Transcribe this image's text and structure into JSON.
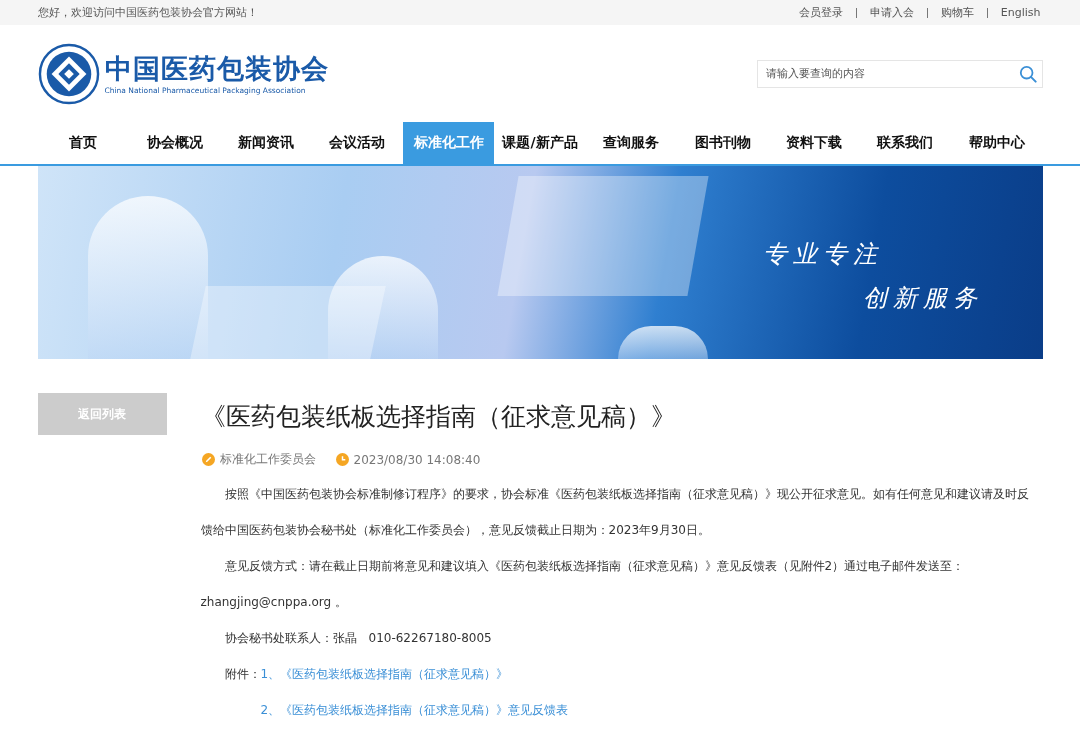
{
  "top_bar": {
    "greeting": "您好，欢迎访问中国医药包装协会官方网站！",
    "links": [
      "会员登录",
      "申请入会",
      "购物车",
      "English"
    ]
  },
  "header": {
    "logo_title": "中国医药包装协会",
    "logo_subtitle": "China National Pharmaceutical Packaging Association",
    "search": {
      "placeholder": "请输入要查询的内容"
    }
  },
  "nav": [
    {
      "label": "首页",
      "selected": false
    },
    {
      "label": "协会概况",
      "selected": false
    },
    {
      "label": "新闻资讯",
      "selected": false
    },
    {
      "label": "会议活动",
      "selected": false
    },
    {
      "label": "标准化工作",
      "selected": true
    },
    {
      "label": "课题/新产品",
      "selected": false
    },
    {
      "label": "查询服务",
      "selected": false
    },
    {
      "label": "图书刊物",
      "selected": false
    },
    {
      "label": "资料下载",
      "selected": false
    },
    {
      "label": "联系我们",
      "selected": false
    },
    {
      "label": "帮助中心",
      "selected": false
    }
  ],
  "banner": {
    "slogan": [
      "专业专注",
      "创新服务"
    ]
  },
  "sidebar": {
    "back_button": "返回列表"
  },
  "article": {
    "title": "《医药包装纸板选择指南（征求意见稿）》",
    "author": "标准化工作委员会",
    "date": "2023/08/30 14:08:40",
    "paragraphs": [
      {
        "kind": "indent",
        "text": "按照《中国医药包装协会标准制修订程序》的要求，协会标准《医药包装纸板选择指南（征求意见稿）》现公开征求意见。如有任何意见和建议请及时反馈给中国医药包装协会秘书处（标准化工作委员会），意见反馈截止日期为：2023年9月30日。"
      },
      {
        "kind": "indent",
        "text": "意见反馈方式：请在截止日期前将意见和建议填入《医药包装纸板选择指南（征求意见稿）》意见反馈表（见附件2）通过电子邮件发送至：zhangjing@cnppa.org 。"
      },
      {
        "kind": "indent",
        "text": "协会秘书处联系人：张晶　010-62267180-8005"
      }
    ],
    "attachments_label": "附件：",
    "attachments": [
      "1、《医药包装纸板选择指南（征求意见稿）》",
      "2、《医药包装纸板选择指南（征求意见稿）》意见反馈表"
    ]
  }
}
